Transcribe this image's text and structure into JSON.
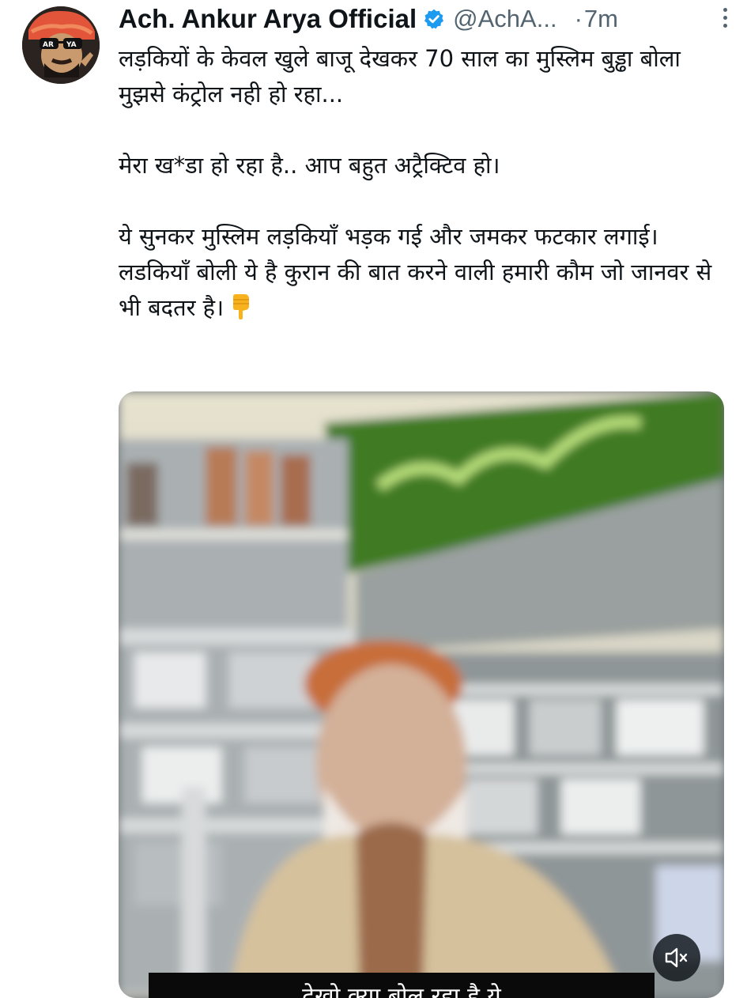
{
  "author": {
    "display_name": "Ach. Ankur Arya Official",
    "verified_icon": "verified-badge-icon",
    "handle": "@AchA...",
    "separator": "·",
    "timestamp": "7m",
    "avatar_text": "AR YA"
  },
  "tweet": {
    "lines": [
      "लड़कियों के केवल खुले बाजू देखकर 70 साल का मुस्लिम बुड्ढा बोला मुझसे कंट्रोल नही हो रहा...",
      "मेरा ख*डा हो रहा है.. आप बहुत अट्रैक्टिव हो।",
      "ये सुनकर मुस्लिम लड़कियाँ भड़क गई और जमकर फटकार लगाई।",
      "लडकियाँ बोली ये है कुरान की बात करने वाली हमारी कौम जो जानवर से भी बदतर है।"
    ],
    "trailing_emoji": "backhand-index-pointing-down-emoji"
  },
  "media": {
    "type": "video",
    "caption_text": "देखो क्या बोल रहा है ये",
    "mute_icon": "speaker-muted-icon"
  },
  "colors": {
    "text": "#0f1419",
    "secondary": "#536471",
    "verified": "#1d9bf0"
  }
}
